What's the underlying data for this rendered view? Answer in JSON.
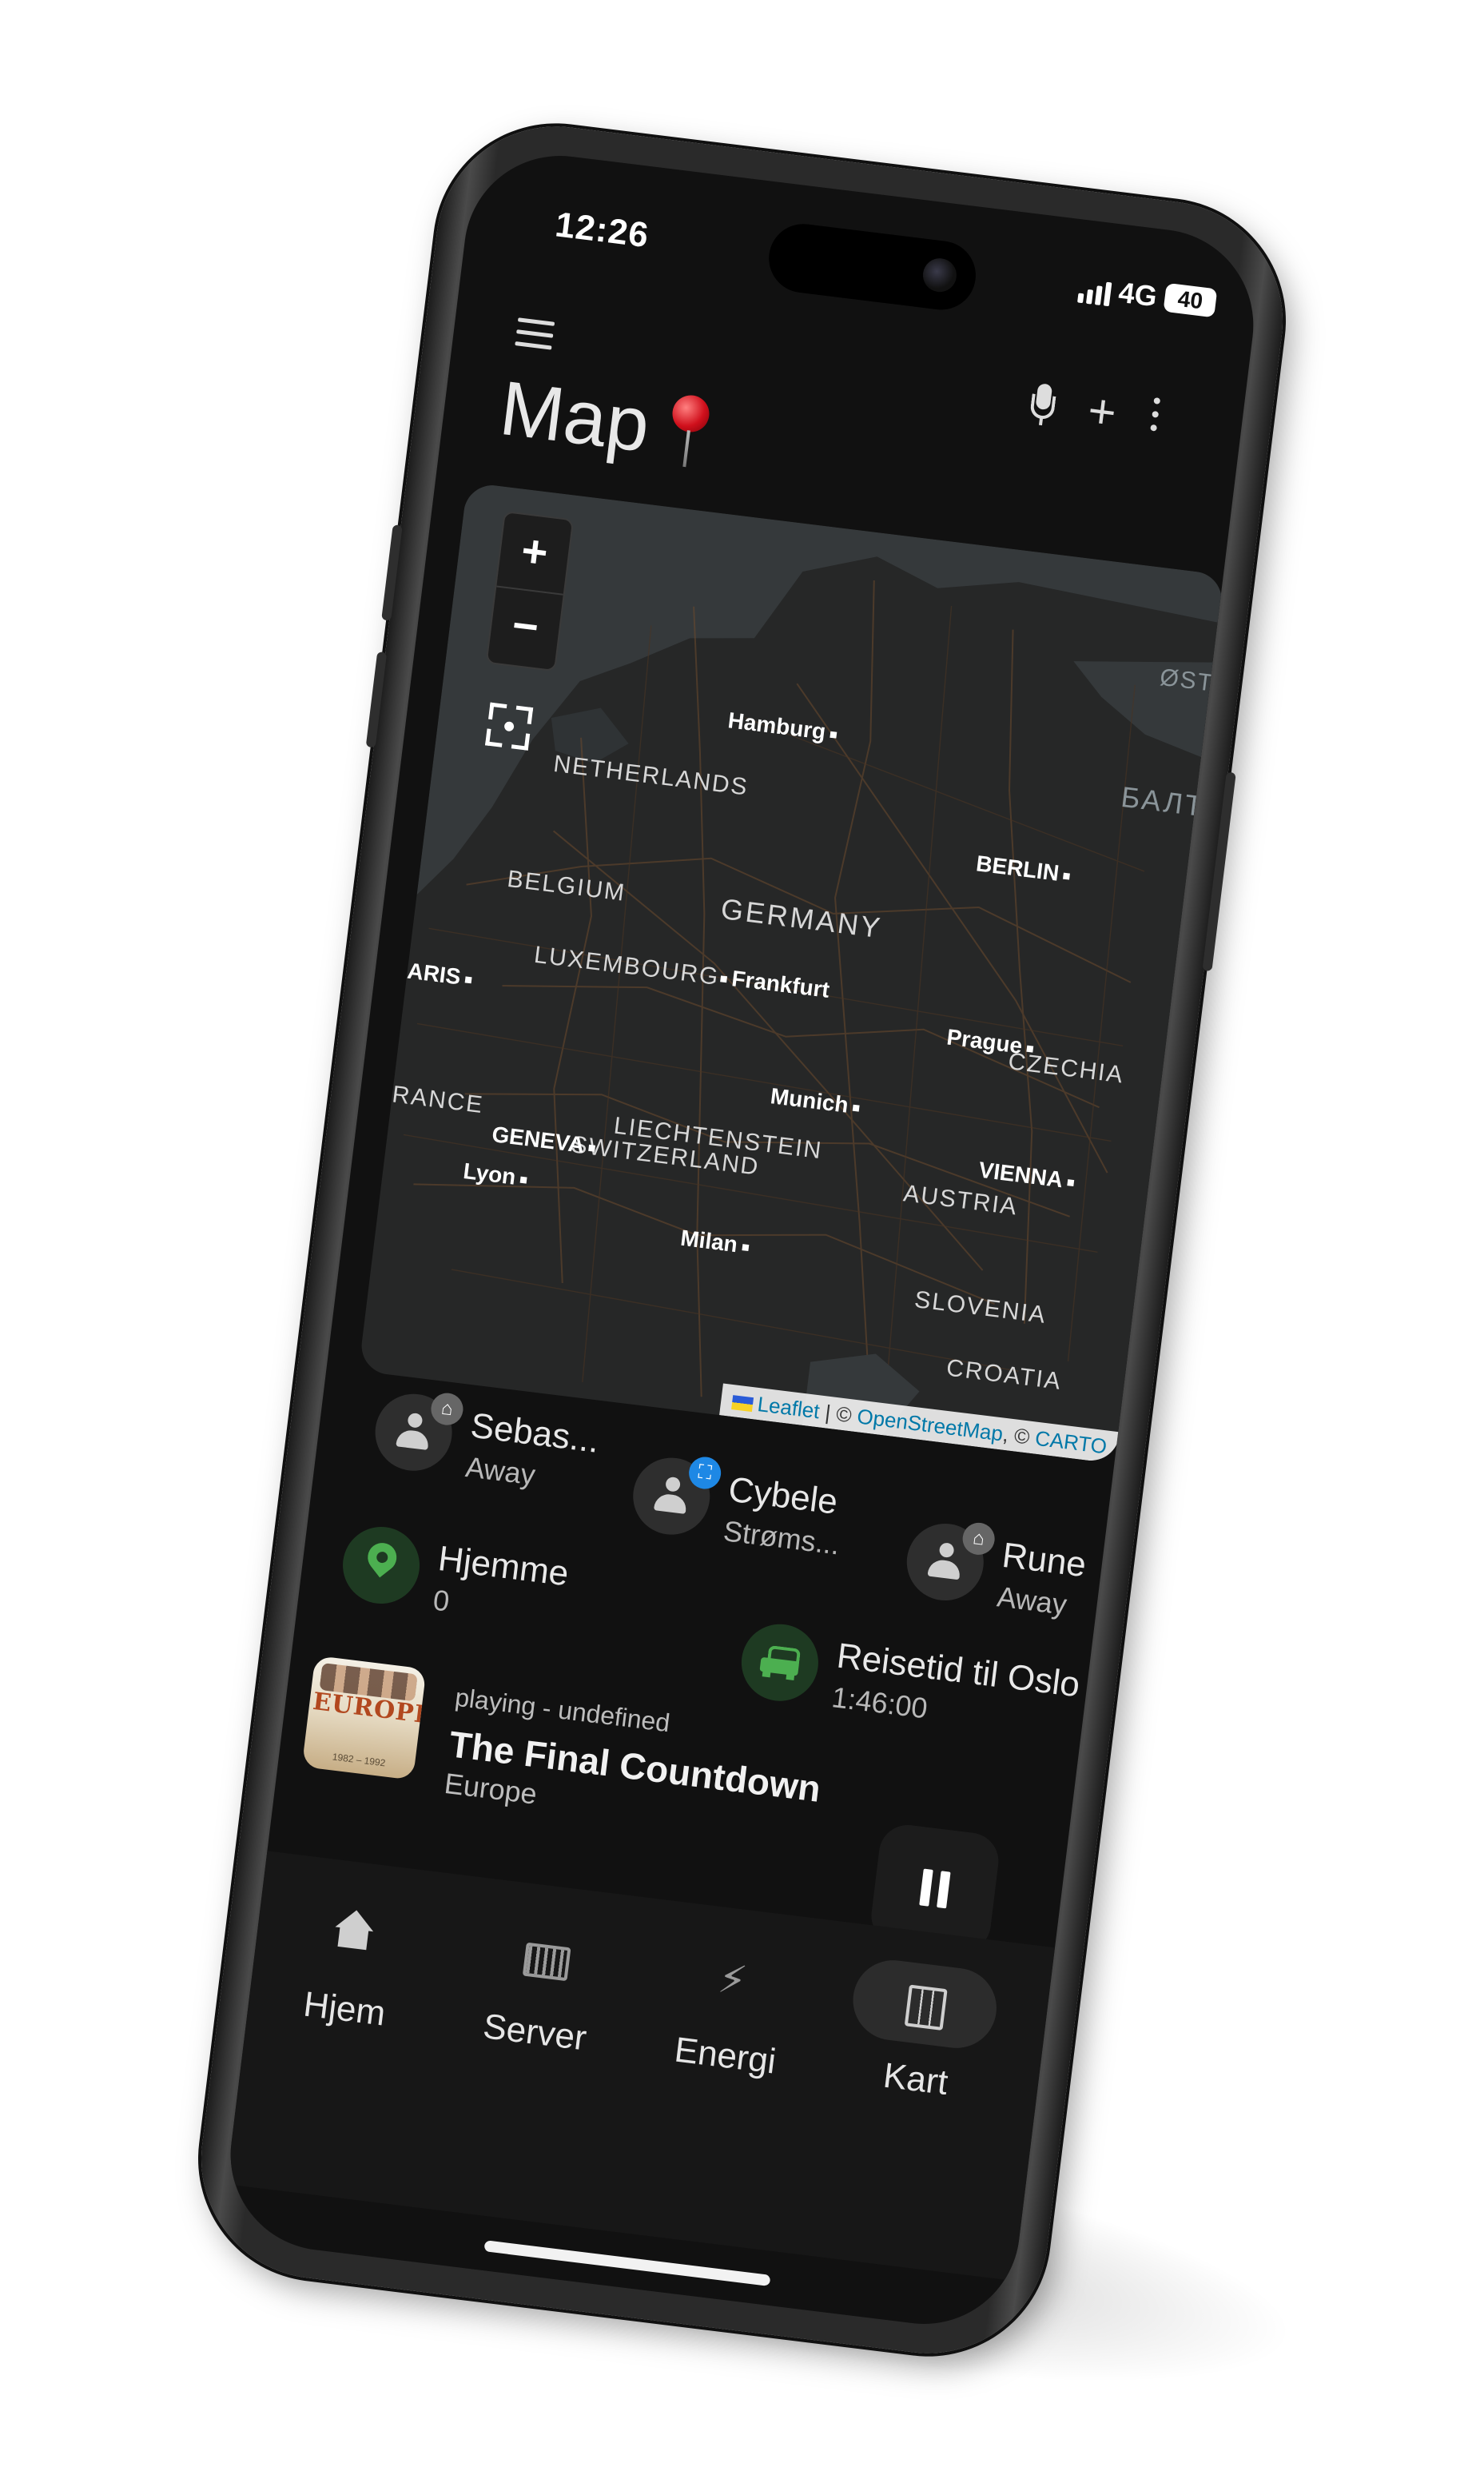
{
  "status": {
    "time": "12:26",
    "network": "4G",
    "battery": "40"
  },
  "header": {
    "menu_icon": "menu-icon",
    "title": "Map",
    "title_icon": "pushpin-icon",
    "actions": [
      "mic-icon",
      "plus-icon",
      "more-vert-icon"
    ]
  },
  "map": {
    "zoom_in": "+",
    "zoom_out": "−",
    "countries": [
      "NETHERLANDS",
      "BELGIUM",
      "GERMANY",
      "LUXEMBOURG",
      "CZECHIA",
      "RANCE",
      "LIECHTENSTEIN",
      "SWITZERLAND",
      "AUSTRIA",
      "SLOVENIA",
      "CROATIA"
    ],
    "cities": [
      "Hamburg",
      "BERLIN",
      "Frankfurt",
      "ARIS",
      "Prague",
      "Munich",
      "VIENNA",
      "GENEVA",
      "Lyon",
      "Milan"
    ],
    "edge_labels": [
      "Øst",
      "Балт"
    ],
    "attribution": {
      "leaflet": "Leaflet",
      "sep": " | © ",
      "osm": "OpenStreetMap",
      "sep2": ", © ",
      "carto": "CARTO"
    }
  },
  "entities": [
    {
      "name": "Sebas...",
      "state": "Away",
      "icon": "person-icon",
      "badge": "leave-home-icon"
    },
    {
      "name": "Cybele",
      "state": "Strøms...",
      "icon": "person-icon",
      "badge": "zone-icon"
    },
    {
      "name": "Rune",
      "state": "Away",
      "icon": "person-icon",
      "badge": "leave-home-icon"
    },
    {
      "name": "Hjemme",
      "state": "0",
      "icon": "map-marker-icon"
    },
    {
      "name": "Reisetid til Oslo",
      "state": "1:46:00",
      "icon": "car-icon"
    }
  ],
  "media": {
    "status": "playing - undefined",
    "track": "The Final Countdown",
    "artist": "Europe",
    "album_art_text": "EUROPE",
    "album_art_years": "1982 – 1992",
    "control": "pause-icon"
  },
  "nav": [
    {
      "label": "Hjem",
      "icon": "home-icon",
      "active": false
    },
    {
      "label": "Server",
      "icon": "server-icon",
      "active": false
    },
    {
      "label": "Energi",
      "icon": "lightning-bolt-icon",
      "active": false
    },
    {
      "label": "Kart",
      "icon": "map-icon",
      "active": true
    }
  ],
  "colors": {
    "background": "#111111",
    "accent_green": "#4caf50",
    "badge_blue": "#1e88e5",
    "text": "#e8e8e8"
  }
}
